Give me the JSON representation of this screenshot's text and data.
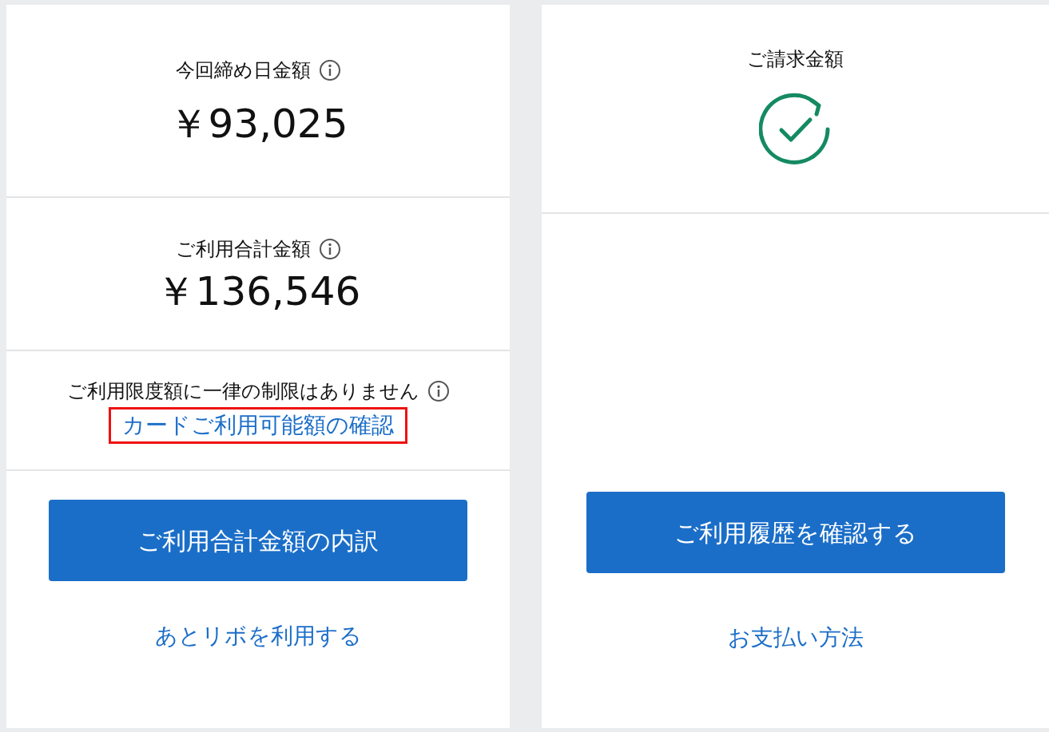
{
  "left_panel": {
    "sections": [
      {
        "kind": "amount",
        "title": "今回締め日金額",
        "info": true,
        "amount": "￥93,025"
      },
      {
        "kind": "amount",
        "title": "ご利用合計金額",
        "info": true,
        "amount": "￥136,546"
      },
      {
        "kind": "note",
        "title": "ご利用限度額に一律の制限はありません",
        "info": true,
        "link": "カードご利用可能額の確認",
        "highlighted": true
      }
    ],
    "button": "ご利用合計金額の内訳",
    "link": "あとリボを利用する"
  },
  "right_panel": {
    "title": "ご請求金額",
    "button": "ご利用履歴を確認する",
    "link": "お支払い方法"
  }
}
